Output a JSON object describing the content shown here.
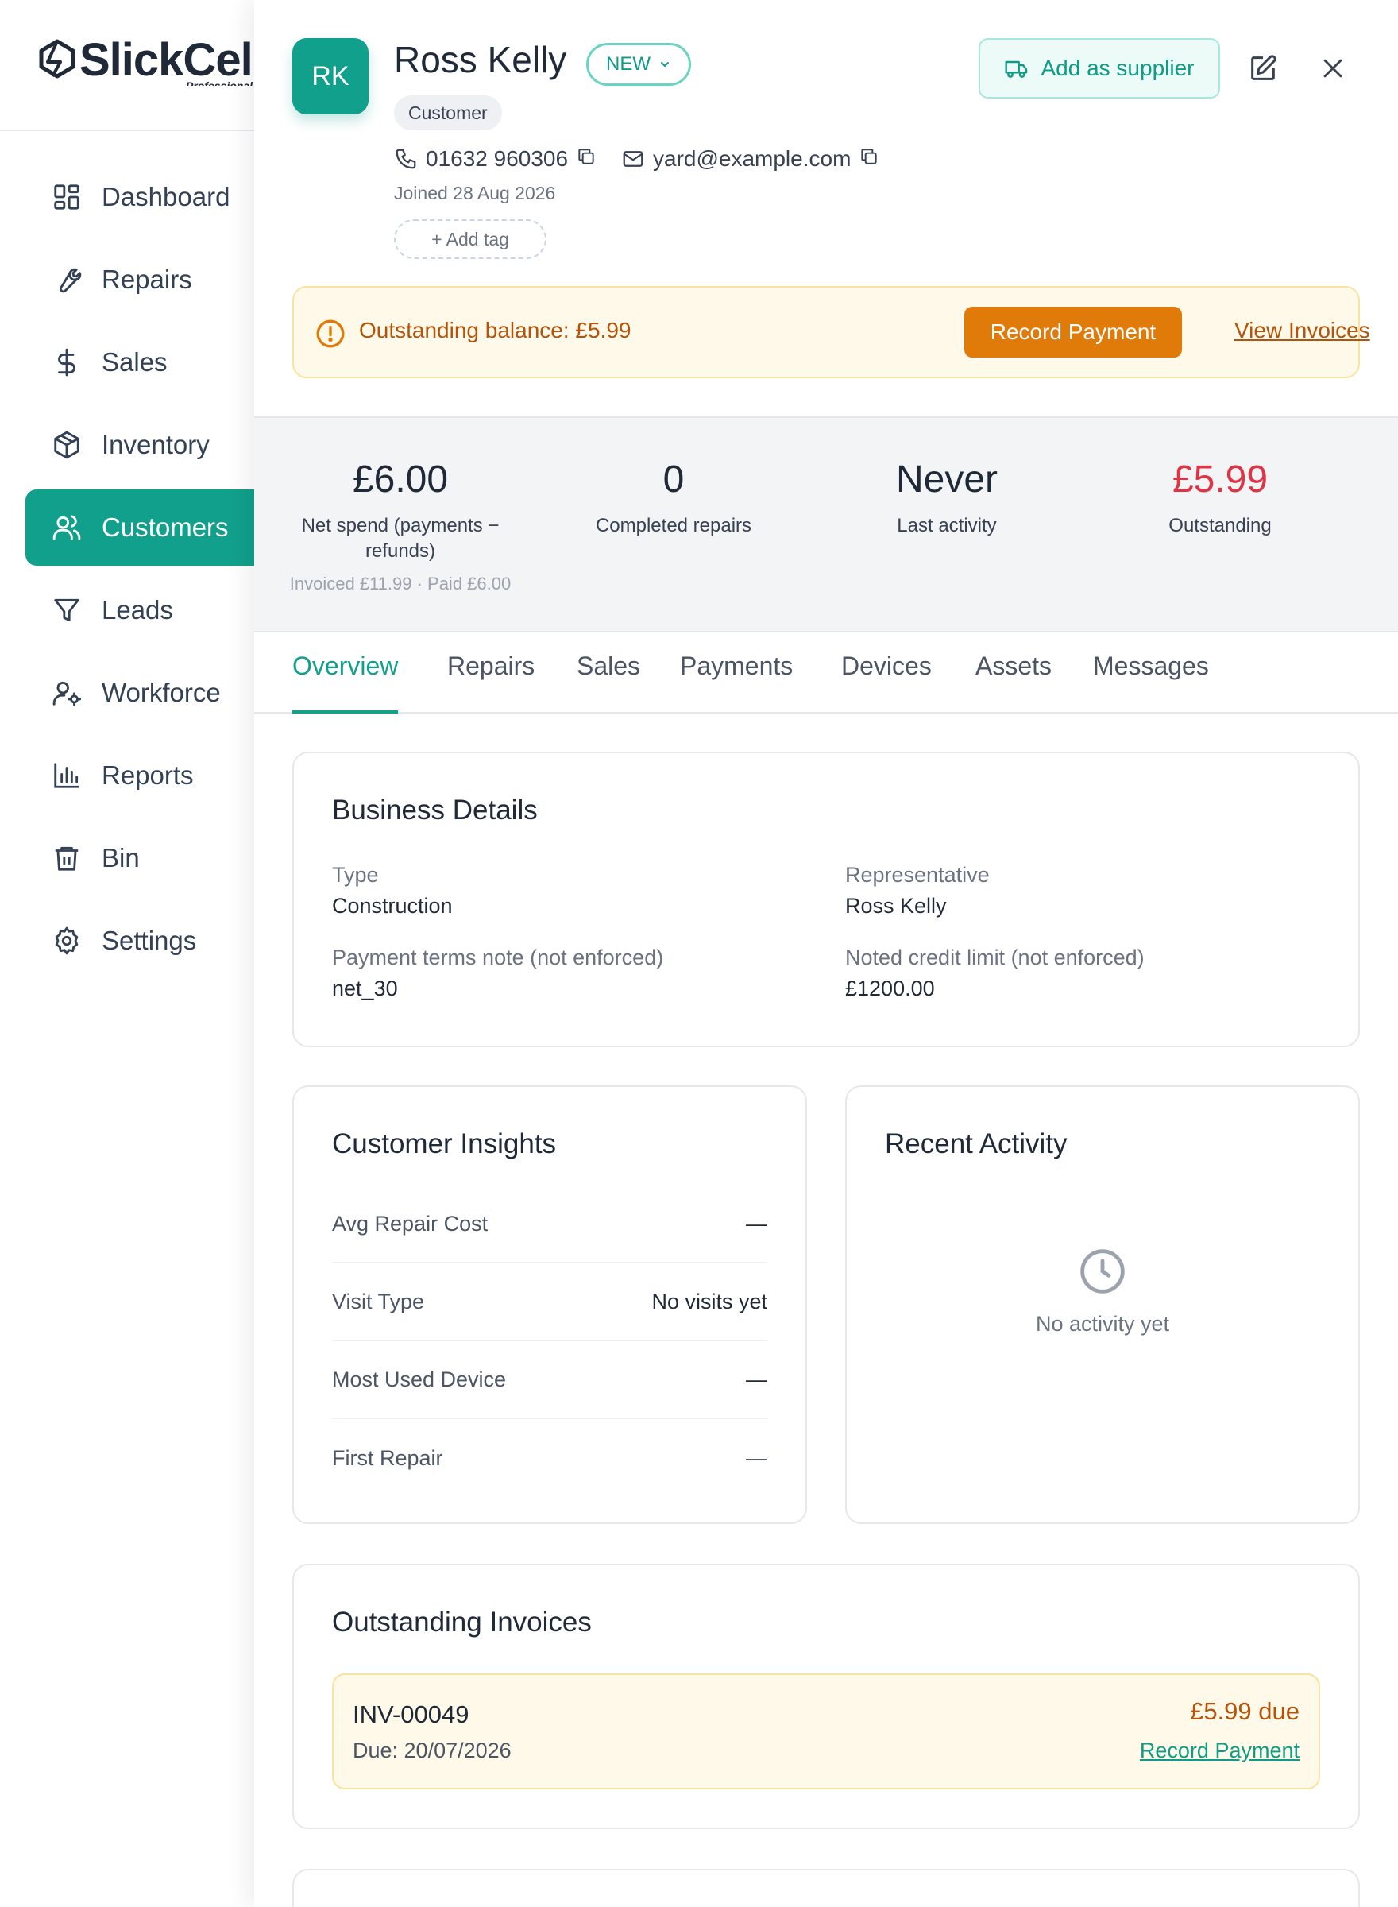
{
  "brand": {
    "name": "SlickCell",
    "edition": "Professional"
  },
  "sidebar": {
    "items": [
      {
        "label": "Dashboard",
        "icon": "dashboard-icon",
        "active": false
      },
      {
        "label": "Repairs",
        "icon": "wrench-icon",
        "active": false
      },
      {
        "label": "Sales",
        "icon": "dollar-icon",
        "active": false
      },
      {
        "label": "Inventory",
        "icon": "box-icon",
        "active": false
      },
      {
        "label": "Customers",
        "icon": "users-icon",
        "active": true
      },
      {
        "label": "Leads",
        "icon": "funnel-icon",
        "active": false
      },
      {
        "label": "Workforce",
        "icon": "user-gear-icon",
        "active": false
      },
      {
        "label": "Reports",
        "icon": "bar-chart-icon",
        "active": false
      },
      {
        "label": "Bin",
        "icon": "trash-icon",
        "active": false
      },
      {
        "label": "Settings",
        "icon": "gear-icon",
        "active": false
      }
    ]
  },
  "customer": {
    "initials": "RK",
    "name": "Ross Kelly",
    "status_badge": "NEW",
    "role": "Customer",
    "phone": "01632 960306",
    "email": "yard@example.com",
    "joined": "Joined 28 Aug 2026",
    "add_tag_label": "+ Add tag"
  },
  "header_actions": {
    "add_supplier_label": "Add as supplier"
  },
  "alert": {
    "text": "Outstanding balance: £5.99",
    "record_payment_label": "Record Payment",
    "view_invoices_label": "View Invoices"
  },
  "stats": [
    {
      "value": "£6.00",
      "label": "Net spend (payments − refunds)",
      "sub": "Invoiced £11.99 · Paid £6.00"
    },
    {
      "value": "0",
      "label": "Completed repairs",
      "sub": ""
    },
    {
      "value": "Never",
      "label": "Last activity",
      "sub": ""
    },
    {
      "value": "£5.99",
      "label": "Outstanding",
      "sub": ""
    }
  ],
  "tabs": [
    {
      "label": "Overview",
      "active": true
    },
    {
      "label": "Repairs",
      "active": false
    },
    {
      "label": "Sales",
      "active": false
    },
    {
      "label": "Payments",
      "active": false
    },
    {
      "label": "Devices",
      "active": false
    },
    {
      "label": "Assets",
      "active": false
    },
    {
      "label": "Messages",
      "active": false
    }
  ],
  "business_details": {
    "title": "Business Details",
    "fields": [
      {
        "label": "Type",
        "value": "Construction"
      },
      {
        "label": "Representative",
        "value": "Ross Kelly"
      },
      {
        "label": "Payment terms note (not enforced)",
        "value": "net_30"
      },
      {
        "label": "Noted credit limit (not enforced)",
        "value": "£1200.00"
      }
    ]
  },
  "insights": {
    "title": "Customer Insights",
    "rows": [
      {
        "label": "Avg Repair Cost",
        "value": "—"
      },
      {
        "label": "Visit Type",
        "value": "No visits yet"
      },
      {
        "label": "Most Used Device",
        "value": "—"
      },
      {
        "label": "First Repair",
        "value": "—"
      }
    ]
  },
  "recent_activity": {
    "title": "Recent Activity",
    "empty_text": "No activity yet"
  },
  "outstanding_invoices": {
    "title": "Outstanding Invoices",
    "items": [
      {
        "number": "INV-00049",
        "due": "Due: 20/07/2026",
        "amount": "£5.99 due",
        "action": "Record Payment"
      }
    ]
  },
  "colors": {
    "accent": "#11a08c",
    "warning_bg": "#fef9e8",
    "warning_text": "#b45309",
    "warning_button": "#e07b0a",
    "danger": "#dc3545"
  }
}
